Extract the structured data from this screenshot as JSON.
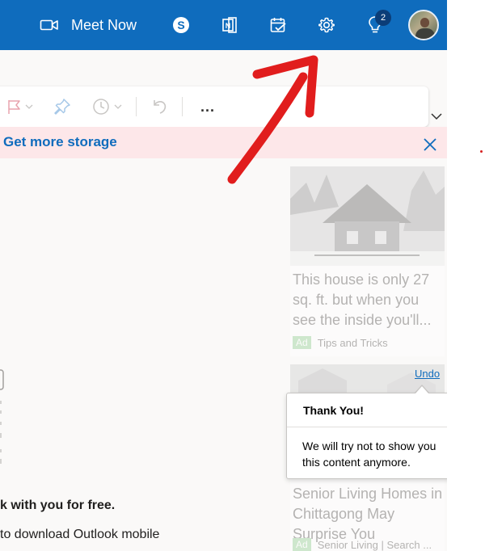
{
  "topbar": {
    "meet_now_label": "Meet Now",
    "tips_badge": "2",
    "icons": [
      "video-camera-icon",
      "skype-icon",
      "office-icon",
      "my-day-icon",
      "gear-icon",
      "lightbulb-icon"
    ],
    "brand_color": "#0f6cbd"
  },
  "toolbar": {
    "more_label": "...",
    "icons": [
      "flag-icon",
      "pin-icon",
      "clock-icon",
      "undo-icon",
      "chevron-down-icon"
    ]
  },
  "banner": {
    "link": "Get more storage",
    "background": "#fde7e9"
  },
  "reading": {
    "promo_title": "k with you for free.",
    "promo_sub": "to download Outlook mobile"
  },
  "ads": [
    {
      "text": "This house is only 27 sq. ft. but when you see the inside you'll...",
      "tag": "Ad",
      "source": "Tips and Tricks"
    },
    {
      "text": "Senior Living Homes in Chittagong May Surprise You",
      "tag": "Ad",
      "source": "Senior Living | Search ..."
    }
  ],
  "undo_label": "Undo",
  "tooltip": {
    "title": "Thank You!",
    "body": "We will try not to show you this content anymore."
  },
  "annotation_color": "#e11d1d"
}
